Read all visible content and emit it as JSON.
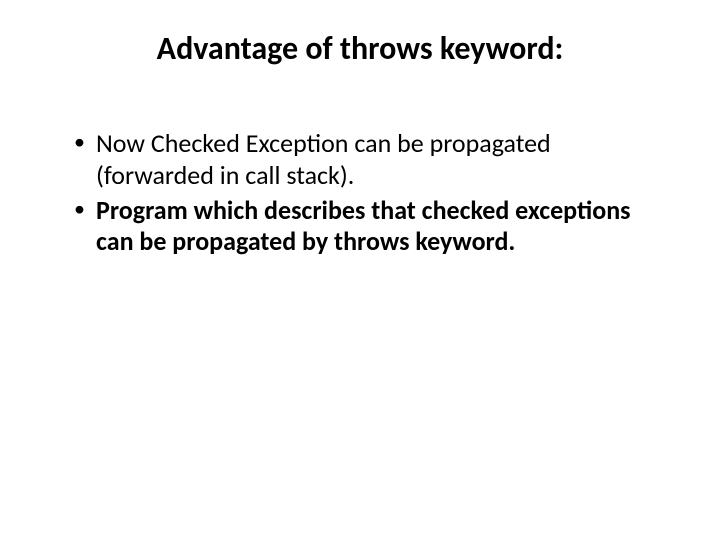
{
  "title": "Advantage of throws keyword:",
  "bullets": [
    {
      "text": "Now Checked Exception can be propagated (forwarded in call stack).",
      "bold": false
    },
    {
      "text": "Program which describes that checked exceptions can be propagated by throws keyword.",
      "bold": true
    }
  ]
}
